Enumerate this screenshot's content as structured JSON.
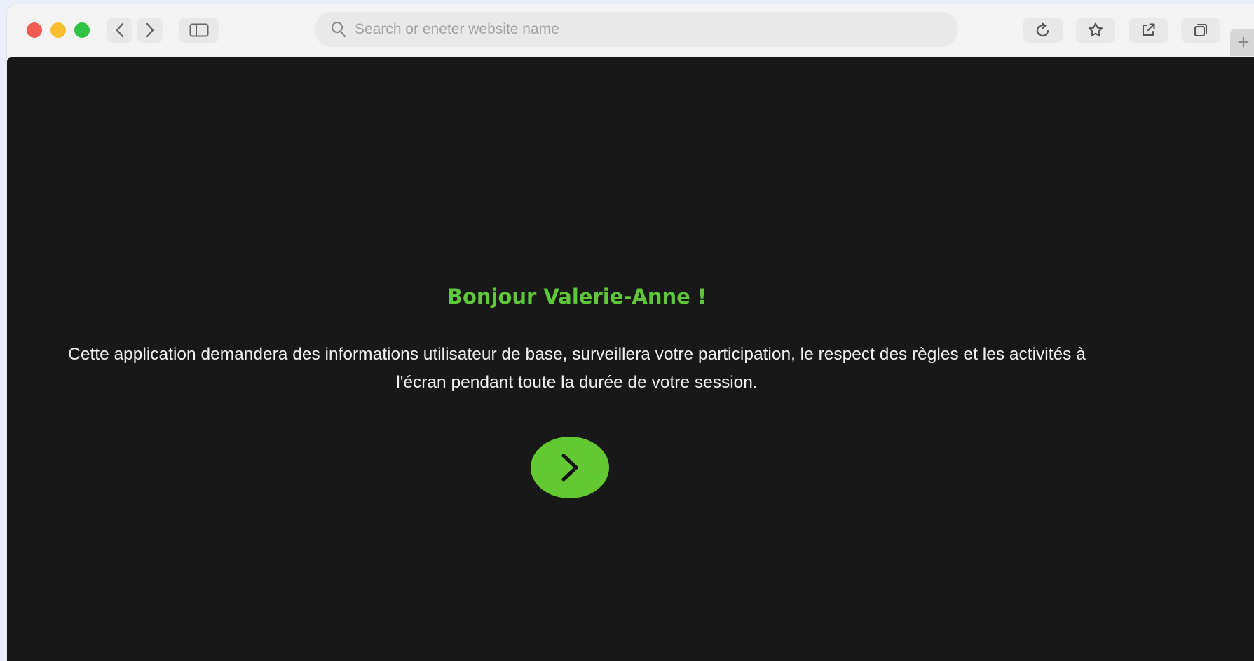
{
  "browser": {
    "search_placeholder": "Search or eneter website name",
    "icons": [
      "back-icon",
      "forward-icon",
      "sidebar-icon",
      "search-icon",
      "reload-icon",
      "bookmark-star-icon",
      "share-icon",
      "tabs-icon",
      "new-tab-plus-icon"
    ],
    "new_tab_label": "+"
  },
  "page": {
    "greeting": "Bonjour Valerie-Anne !",
    "message": "Cette application demandera des informations utilisateur de base, surveillera votre participation, le respect des règles et les activités à l'écran pendant toute la durée de votre session.",
    "next_icon": "chevron-right-icon"
  },
  "colors": {
    "accent": "#63c933",
    "background": "#181818",
    "text": "#f1f1f1"
  }
}
